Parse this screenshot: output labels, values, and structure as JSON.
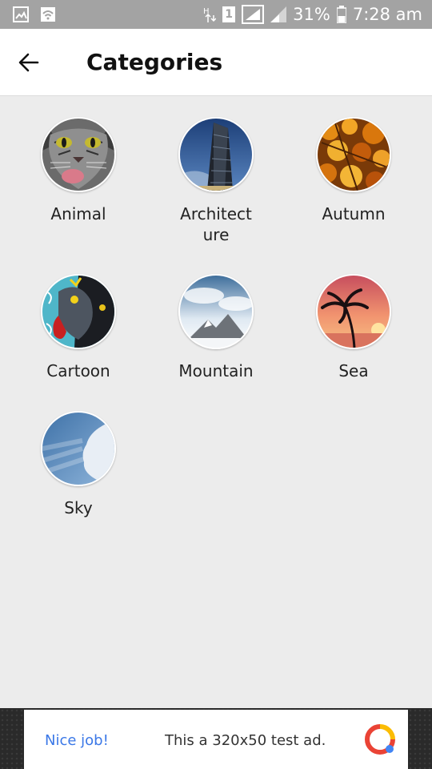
{
  "status_bar": {
    "battery": "31%",
    "time": "7:28 am",
    "sim_slot": "1"
  },
  "header": {
    "title": "Categories"
  },
  "categories": [
    {
      "label": "Animal",
      "icon": "animal-thumbnail"
    },
    {
      "label": "Architect ure",
      "icon": "architecture-thumbnail"
    },
    {
      "label": "Autumn",
      "icon": "autumn-thumbnail"
    },
    {
      "label": "Cartoon",
      "icon": "cartoon-thumbnail"
    },
    {
      "label": "Mountain",
      "icon": "mountain-thumbnail"
    },
    {
      "label": "Sea",
      "icon": "sea-thumbnail"
    },
    {
      "label": "Sky",
      "icon": "sky-thumbnail"
    }
  ],
  "ad": {
    "link_text": "Nice job!",
    "message": "This a 320x50 test ad."
  },
  "colors": {
    "background": "#ececec",
    "status_bar": "#a3a3a3",
    "ad_link": "#3b78e7"
  }
}
